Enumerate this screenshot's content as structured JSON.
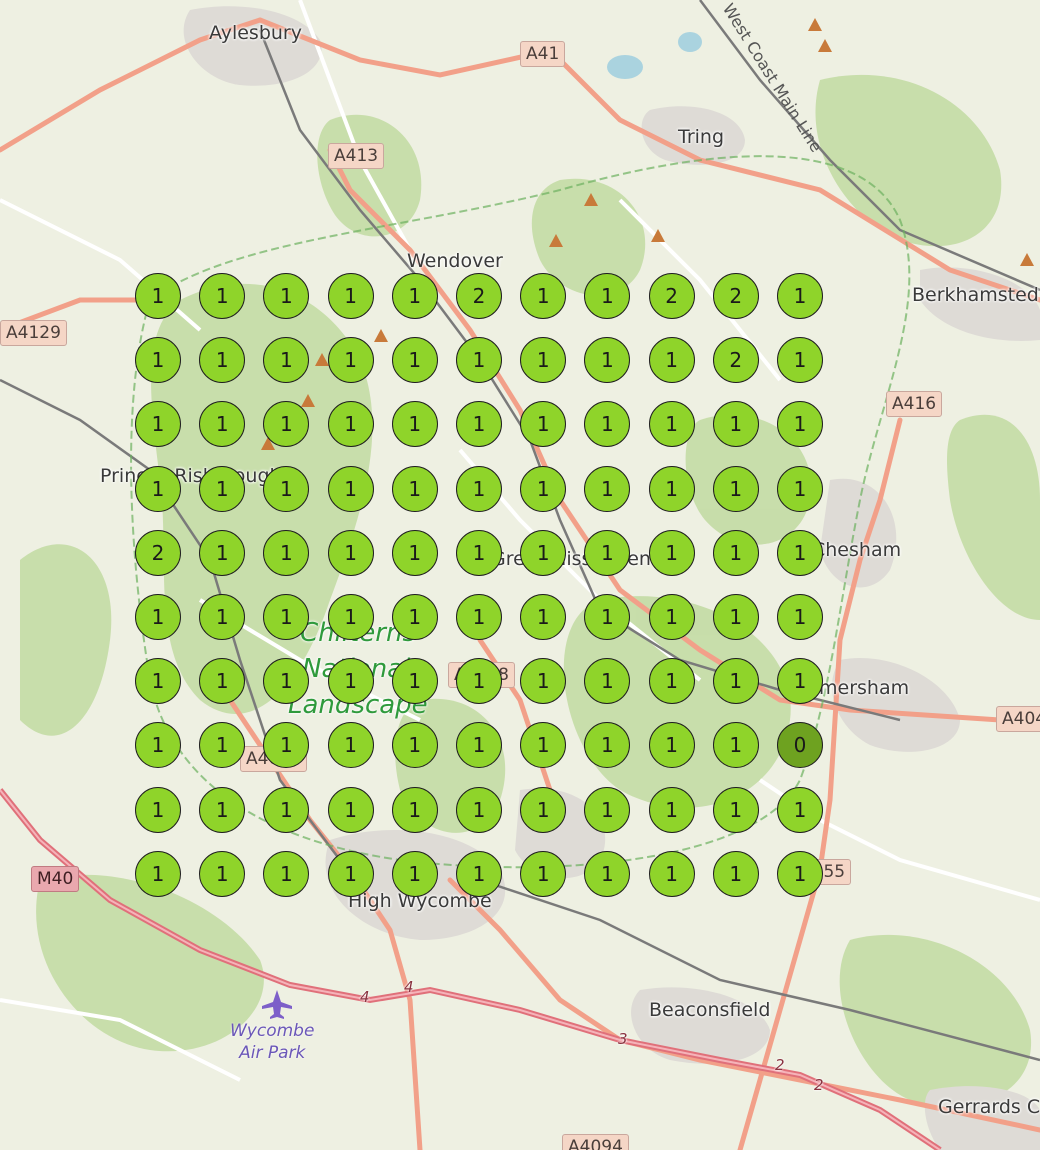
{
  "places": {
    "aylesbury": "Aylesbury",
    "tring": "Tring",
    "wendover": "Wendover",
    "berkhamsted": "Berkhamsted",
    "princes_risborough": "Princes Risborough",
    "chesham": "Chesham",
    "amersham": "Amersham",
    "great_missenden": "Great Missenden",
    "high_wycombe": "High Wycombe",
    "beaconsfield": "Beaconsfield",
    "gerrards_cross": "Gerrards Cross"
  },
  "park": {
    "line1": "Chilterns",
    "line2": "National",
    "line3": "Landscape"
  },
  "airport": {
    "line1": "Wycombe",
    "line2": "Air Park"
  },
  "railway": "West Coast Main Line",
  "roads": {
    "a41": "A41",
    "a413": "A413",
    "a4129": "A4129",
    "a416": "A416",
    "a404": "A404",
    "a4010": "A4010",
    "a4128": "A4128",
    "a355": "A355",
    "m40": "M40",
    "a4094": "A4094"
  },
  "junctions": {
    "j4a": "4",
    "j4b": "4",
    "j3": "3",
    "j2a": "2",
    "j2b": "2"
  },
  "colors": {
    "marker_fill": "#8fd42a",
    "marker_fill_zero": "#6ea220",
    "marker_border": "#1f1f1f"
  },
  "grid": {
    "counts": [
      [
        1,
        1,
        1,
        1,
        1,
        2,
        1,
        1,
        2,
        2,
        1
      ],
      [
        1,
        1,
        1,
        1,
        1,
        1,
        1,
        1,
        1,
        2,
        1
      ],
      [
        1,
        1,
        1,
        1,
        1,
        1,
        1,
        1,
        1,
        1,
        1
      ],
      [
        1,
        1,
        1,
        1,
        1,
        1,
        1,
        1,
        1,
        1,
        1
      ],
      [
        2,
        1,
        1,
        1,
        1,
        1,
        1,
        1,
        1,
        1,
        1
      ],
      [
        1,
        1,
        1,
        1,
        1,
        1,
        1,
        1,
        1,
        1,
        1
      ],
      [
        1,
        1,
        1,
        1,
        1,
        1,
        1,
        1,
        1,
        1,
        1
      ],
      [
        1,
        1,
        1,
        1,
        1,
        1,
        1,
        1,
        1,
        1,
        0
      ],
      [
        1,
        1,
        1,
        1,
        1,
        1,
        1,
        1,
        1,
        1,
        1
      ],
      [
        1,
        1,
        1,
        1,
        1,
        1,
        1,
        1,
        1,
        1,
        1
      ]
    ]
  }
}
